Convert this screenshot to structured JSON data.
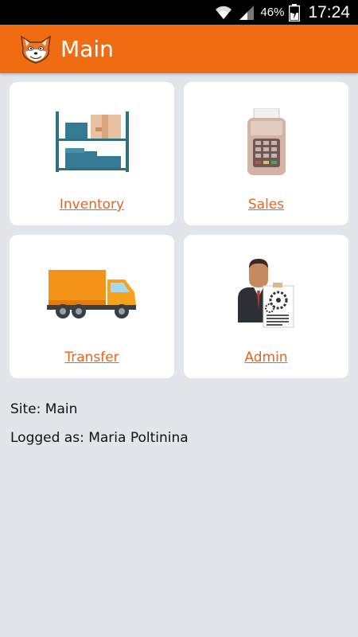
{
  "status_bar": {
    "battery_percent": "46%",
    "time": "17:24",
    "icons": [
      "wifi-icon",
      "cell-signal-icon",
      "battery-charging-icon"
    ]
  },
  "app_bar": {
    "title": "Main",
    "logo_icon": "fox-logo-icon",
    "background_color": "#ef6c13"
  },
  "tiles": [
    {
      "label": "Inventory",
      "icon": "warehouse-shelf-icon"
    },
    {
      "label": "Sales",
      "icon": "card-terminal-icon"
    },
    {
      "label": "Transfer",
      "icon": "delivery-truck-icon"
    },
    {
      "label": "Admin",
      "icon": "admin-businessman-icon"
    }
  ],
  "info": {
    "site": "Site: Main",
    "logged_as": "Logged as: Maria Poltinina"
  },
  "colors": {
    "accent": "#ef6c13",
    "link": "#e8641c",
    "background": "#e2e6ea"
  }
}
